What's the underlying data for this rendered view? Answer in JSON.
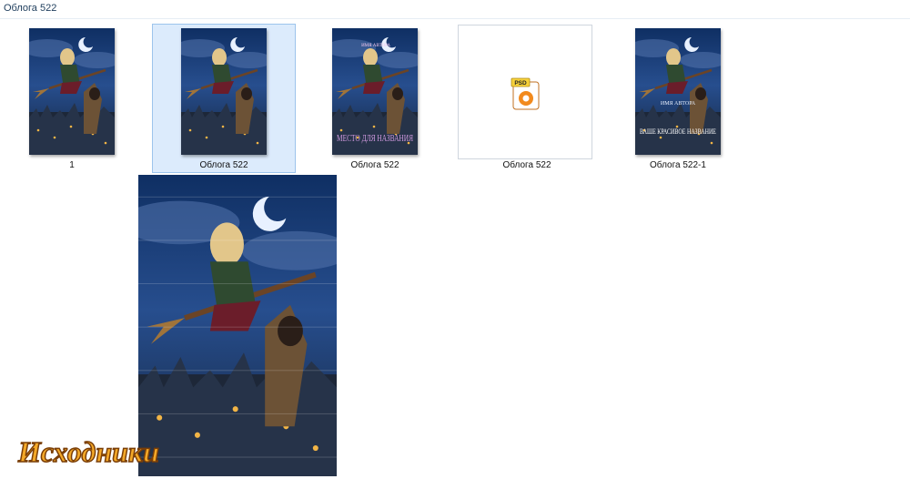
{
  "window": {
    "title": "Облога 522"
  },
  "files": [
    {
      "label": "1",
      "type": "image"
    },
    {
      "label": "Облога  522",
      "type": "image",
      "selected": true
    },
    {
      "label": "Облога 522",
      "type": "image",
      "cover_text": {
        "author": "ИМЯ АВТОРА",
        "title": "МЕСТО ДЛЯ НАЗВАНИЯ"
      }
    },
    {
      "label": "Облога 522",
      "type": "psd",
      "badge": "PSD"
    },
    {
      "label": "Облога 522-1",
      "type": "image",
      "cover_text": {
        "author": "ИМЯ АВТОРА",
        "title": "ВАШЕ КРАСИВОЕ НАЗВАНИЕ"
      }
    }
  ],
  "preview": {
    "kind": "large-cover-preview"
  },
  "watermark": {
    "text": "Исходники"
  },
  "colors": {
    "accent": "#dcebfc",
    "selected_border": "#9dc4ec",
    "psd_orange": "#f28a1d"
  }
}
